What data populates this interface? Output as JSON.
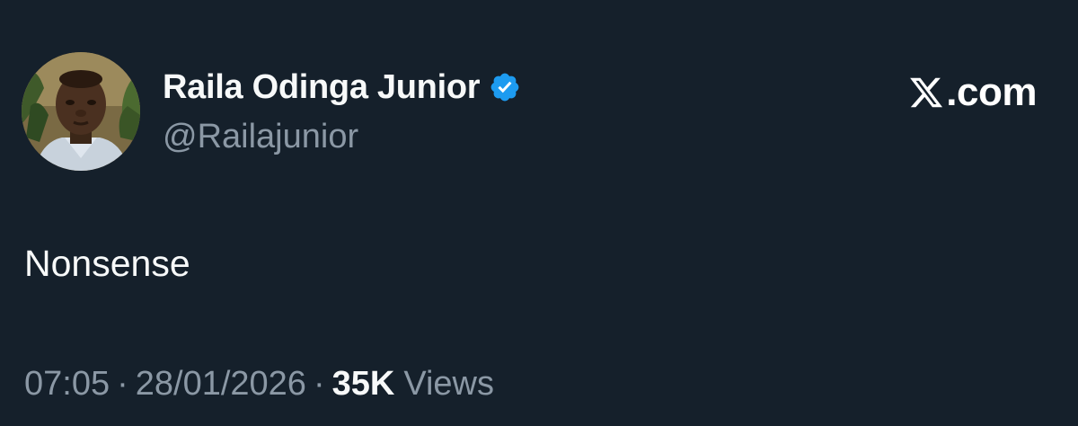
{
  "user": {
    "display_name": "Raila Odinga Junior",
    "handle": "@Railajunior",
    "verified": true,
    "avatar_icon": "profile-photo"
  },
  "site": {
    "logo_icon": "x-logo-icon",
    "domain": ".com"
  },
  "tweet": {
    "text": "Nonsense"
  },
  "meta": {
    "time": "07:05",
    "separator": "·",
    "date": "28/01/2026",
    "views_count": "35K",
    "views_label": "Views"
  },
  "colors": {
    "background": "#15202b",
    "primary_text": "#f7f9f9",
    "secondary_text": "#8b98a5",
    "verified_badge": "#1d9bf0"
  }
}
